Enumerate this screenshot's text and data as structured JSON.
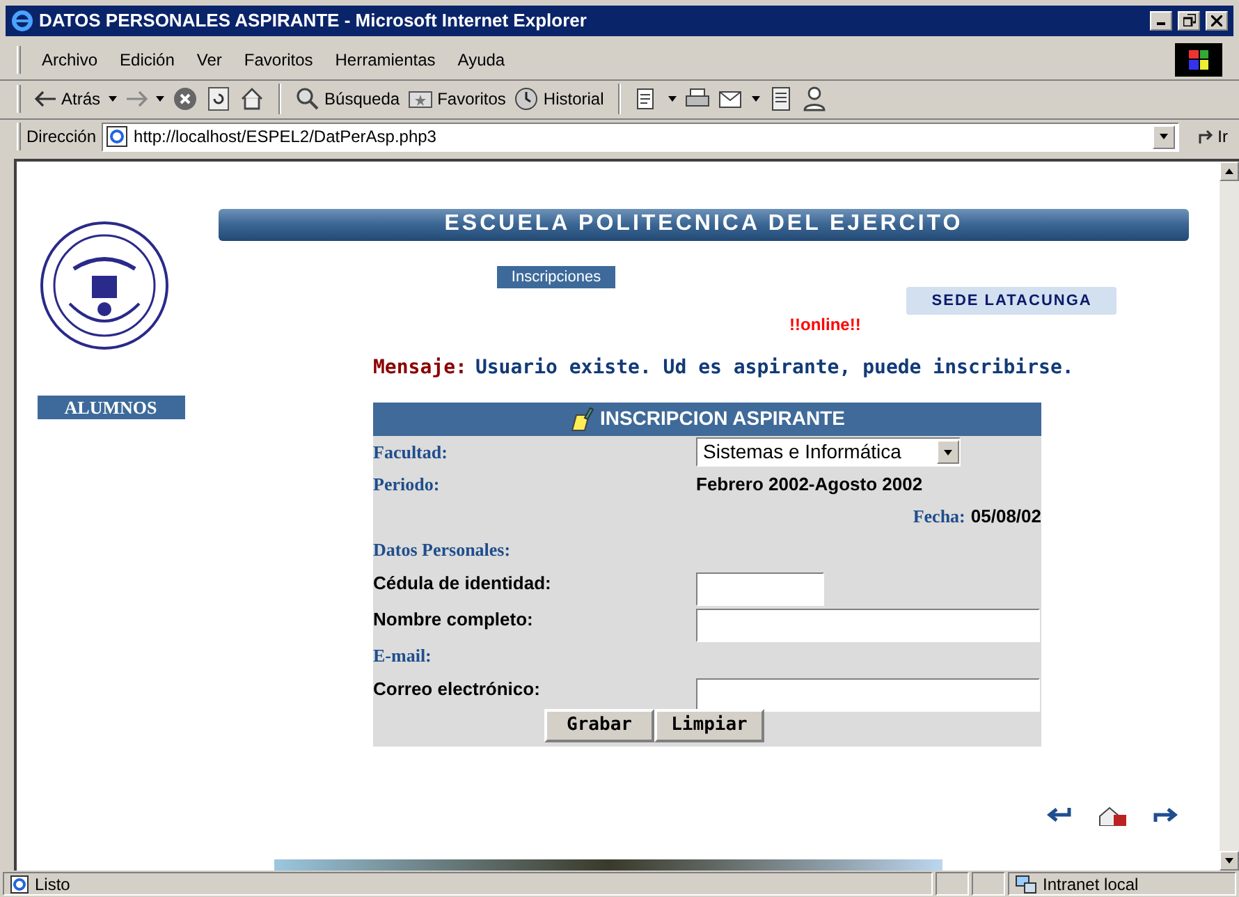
{
  "window": {
    "title": "DATOS PERSONALES ASPIRANTE - Microsoft Internet Explorer"
  },
  "menu": [
    "Archivo",
    "Edición",
    "Ver",
    "Favoritos",
    "Herramientas",
    "Ayuda"
  ],
  "toolbar": [
    {
      "kind": "back",
      "label": "Atrás"
    },
    {
      "kind": "forward"
    },
    {
      "kind": "stop"
    },
    {
      "kind": "refresh"
    },
    {
      "kind": "home"
    },
    {
      "kind": "search",
      "label": "Búsqueda"
    },
    {
      "kind": "favorites",
      "label": "Favoritos"
    },
    {
      "kind": "history",
      "label": "Historial"
    },
    {
      "kind": "edit"
    },
    {
      "kind": "print"
    },
    {
      "kind": "mail"
    },
    {
      "kind": "notes"
    },
    {
      "kind": "messenger"
    }
  ],
  "address": {
    "label": "Dirección",
    "url": "http://localhost/ESPEL2/DatPerAsp.php3",
    "go": "Ir"
  },
  "page": {
    "banner": "ESCUELA POLITECNICA DEL EJERCITO",
    "nav_button": "Inscripciones",
    "sede": "SEDE LATACUNGA",
    "online": "!!online!!",
    "message": {
      "label": "Mensaje:",
      "text": "Usuario existe. Ud es aspirante, puede inscribirse."
    },
    "sidebar_button": "ALUMNOS",
    "form": {
      "title": "INSCRIPCION ASPIRANTE",
      "rows": [
        {
          "kind": "select",
          "label": "Facultad:",
          "value": "Sistemas e Informática"
        },
        {
          "kind": "static",
          "label": "Periodo:",
          "value": "Febrero 2002-Agosto 2002"
        },
        {
          "kind": "date",
          "label": "Fecha:",
          "value": "05/08/02"
        },
        {
          "kind": "section",
          "label": "Datos Personales:"
        },
        {
          "kind": "input",
          "label": "Cédula de identidad:",
          "wide": false
        },
        {
          "kind": "input",
          "label": "Nombre completo:",
          "wide": true
        },
        {
          "kind": "section",
          "label": "E-mail:"
        },
        {
          "kind": "input",
          "label": "Correo electrónico:",
          "wide": true
        }
      ],
      "buttons": [
        "Grabar",
        "Limpiar"
      ]
    }
  },
  "status_bar": {
    "text": "Listo",
    "zone": "Intranet local"
  }
}
